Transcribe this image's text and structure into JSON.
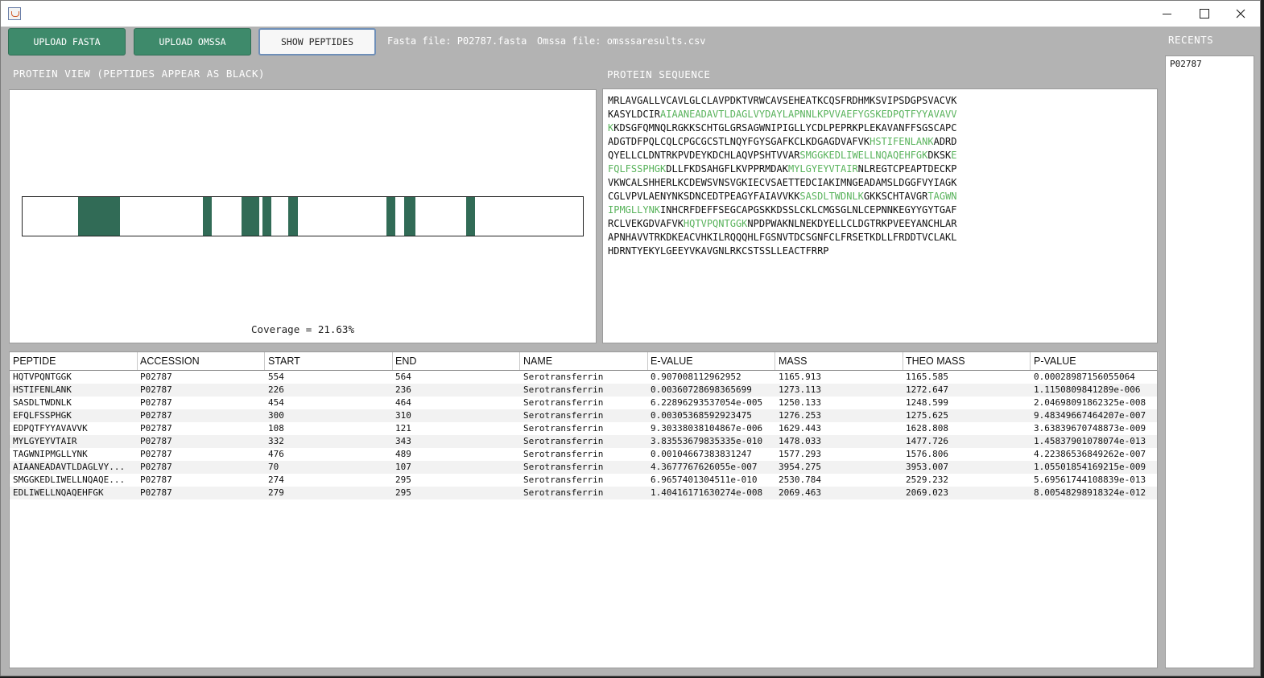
{
  "toolbar": {
    "upload_fasta": "UPLOAD FASTA",
    "upload_omssa": "UPLOAD OMSSA",
    "show_peptides": "SHOW PEPTIDES",
    "fasta_file": "Fasta file: P02787.fasta",
    "omssa_file": "Omssa file: omsssaresults.csv"
  },
  "protein_view": {
    "title": "PROTEIN VIEW (PEPTIDES APPEAR AS BLACK)",
    "coverage_text": "Coverage = 21.63%",
    "protein_length": 698,
    "segments": [
      {
        "start": 70,
        "end": 107
      },
      {
        "start": 108,
        "end": 121
      },
      {
        "start": 226,
        "end": 236
      },
      {
        "start": 274,
        "end": 295
      },
      {
        "start": 279,
        "end": 295
      },
      {
        "start": 300,
        "end": 310
      },
      {
        "start": 332,
        "end": 343
      },
      {
        "start": 454,
        "end": 464
      },
      {
        "start": 476,
        "end": 489
      },
      {
        "start": 554,
        "end": 564
      }
    ],
    "bar_color": "#316b56"
  },
  "sequence": {
    "title": "PROTEIN SEQUENCE",
    "peptide_color": "#59b35c",
    "lines": [
      [
        {
          "t": "MRLAVGALLVCAVLGLCLAVPDKTVRWCAVSEHEATKCQSFRDHMKSVIPSDGPSVACVK",
          "p": false
        }
      ],
      [
        {
          "t": "KASYLDCIR",
          "p": false
        },
        {
          "t": "AIAANEADAVTLDAGLVYDAYLAPNNLKPVVAEFYGSKEDPQTFYYAVAVV",
          "p": true
        }
      ],
      [
        {
          "t": "K",
          "p": true
        },
        {
          "t": "KDSGFQMNQLRGKKSCHTGLGRSAGWNIPIGLLYCDLPEPRKPLEKAVANFFSGSCAPC",
          "p": false
        }
      ],
      [
        {
          "t": "ADGTDFPQLCQLCPGCGCSTLNQYFGYSGAFKCLKDGAGDVAFVK",
          "p": false
        },
        {
          "t": "HSTIFENLANK",
          "p": true
        },
        {
          "t": "ADRD",
          "p": false
        }
      ],
      [
        {
          "t": "QYELLCLDNTRKPVDEYKDCHLAQVPSHTVVAR",
          "p": false
        },
        {
          "t": "SMGGKEDLIWELLNQAQEHFGK",
          "p": true
        },
        {
          "t": "DKSK",
          "p": false
        },
        {
          "t": "E",
          "p": true
        }
      ],
      [
        {
          "t": "FQLFSSPHGK",
          "p": true
        },
        {
          "t": "DLLFKDSAHGFLKVPPRMDAK",
          "p": false
        },
        {
          "t": "MYLGYEYVTAIR",
          "p": true
        },
        {
          "t": "NLREGTCPEAPTDECKP",
          "p": false
        }
      ],
      [
        {
          "t": "VKWCALSHHERLKCDEWSVNSVGKIECVSAETTEDCIAKIMNGEADAMSLDGGFVYIAGK",
          "p": false
        }
      ],
      [
        {
          "t": "CGLVPVLAENYNKSDNCEDTPEAGYFAIAVVKK",
          "p": false
        },
        {
          "t": "SASDLTWDNLK",
          "p": true
        },
        {
          "t": "GKKSCHTAVGR",
          "p": false
        },
        {
          "t": "TAGWN",
          "p": true
        }
      ],
      [
        {
          "t": "IPMGLLYNK",
          "p": true
        },
        {
          "t": "INHCRFDEFFSEGCAPGSKKDSSLCKLCMGSGLNLCEPNNKEGYYGYTGAF",
          "p": false
        }
      ],
      [
        {
          "t": "RCLVEKGDVAFVK",
          "p": false
        },
        {
          "t": "HQTVPQNTGGK",
          "p": true
        },
        {
          "t": "NPDPWAKNLNEKDYELLCLDGTRKPVEEYANCHLAR",
          "p": false
        }
      ],
      [
        {
          "t": "APNHAVVTRKDKEACVHKILRQQQHLFGSNVTDCSGNFCLFRSETKDLLFRDDTVCLAKL",
          "p": false
        }
      ],
      [
        {
          "t": "HDRNTYEKYLGEEYVKAVGNLRKCSTSSLLEACTFRRP",
          "p": false
        }
      ]
    ]
  },
  "table": {
    "columns": [
      "PEPTIDE",
      "ACCESSION",
      "START",
      "END",
      "NAME",
      "E-VALUE",
      "MASS",
      "THEO MASS",
      "P-VALUE"
    ],
    "rows": [
      [
        "HQTVPQNTGGK",
        "P02787",
        "554",
        "564",
        "Serotransferrin",
        "0.907008112962952",
        "1165.913",
        "1165.585",
        "0.00028987156055064"
      ],
      [
        "HSTIFENLANK",
        "P02787",
        "226",
        "236",
        "Serotransferrin",
        "0.00360728698365699",
        "1273.113",
        "1272.647",
        "1.1150809841289e-006"
      ],
      [
        "SASDLTWDNLK",
        "P02787",
        "454",
        "464",
        "Serotransferrin",
        "6.22896293537054e-005",
        "1250.133",
        "1248.599",
        "2.04698091862325e-008"
      ],
      [
        "EFQLFSSPHGK",
        "P02787",
        "300",
        "310",
        "Serotransferrin",
        "0.00305368592923475",
        "1276.253",
        "1275.625",
        "9.48349667464207e-007"
      ],
      [
        "EDPQTFYYAVAVVK",
        "P02787",
        "108",
        "121",
        "Serotransferrin",
        "9.30338038104867e-006",
        "1629.443",
        "1628.808",
        "3.63839670748873e-009"
      ],
      [
        "MYLGYEYVTAIR",
        "P02787",
        "332",
        "343",
        "Serotransferrin",
        "3.83553679835335e-010",
        "1478.033",
        "1477.726",
        "1.45837901078074e-013"
      ],
      [
        "TAGWNIPMGLLYNK",
        "P02787",
        "476",
        "489",
        "Serotransferrin",
        "0.00104667383831247",
        "1577.293",
        "1576.806",
        "4.22386536849262e-007"
      ],
      [
        "AIAANEADAVTLDAGLVY...",
        "P02787",
        "70",
        "107",
        "Serotransferrin",
        "4.3677767626055e-007",
        "3954.275",
        "3953.007",
        "1.05501854169215e-009"
      ],
      [
        "SMGGKEDLIWELLNQAQE...",
        "P02787",
        "274",
        "295",
        "Serotransferrin",
        "6.9657401304511e-010",
        "2530.784",
        "2529.232",
        "5.69561744108839e-013"
      ],
      [
        "EDLIWELLNQAQEHFGK",
        "P02787",
        "279",
        "295",
        "Serotransferrin",
        "1.40416171630274e-008",
        "2069.463",
        "2069.023",
        "8.00548298918324e-012"
      ]
    ]
  },
  "recents": {
    "title": "RECENTS",
    "items": [
      "P02787"
    ]
  }
}
